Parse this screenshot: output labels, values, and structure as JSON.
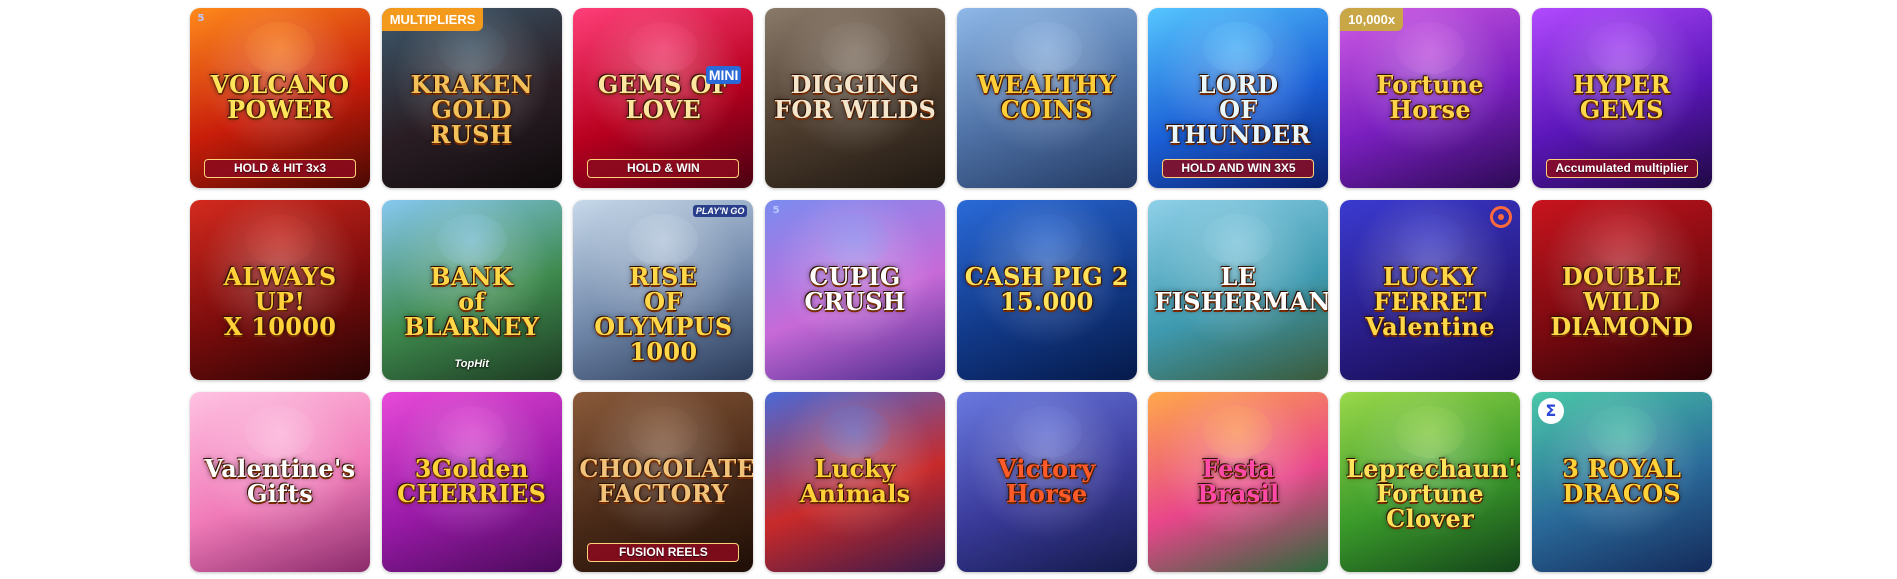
{
  "games": [
    {
      "title": "VOLCANO\nPOWER",
      "subtitle": "HOLD & HIT 3x3",
      "badge": "",
      "colors": [
        "#ff8a1c",
        "#c81d0a",
        "#4a0803"
      ],
      "title_color": "#ffe35a",
      "corner_icon": "five-icon"
    },
    {
      "title": "KRAKEN\nGOLD RUSH",
      "subtitle": "",
      "badge": "MULTIPLIERS",
      "colors": [
        "#3d5a6e",
        "#2a1e24",
        "#0e0a0c"
      ],
      "title_color": "#f2c15a",
      "corner_icon": ""
    },
    {
      "title": "GEMS OF LOVE",
      "subtitle": "HOLD & WIN",
      "badge": "",
      "colors": [
        "#ff3f7a",
        "#b8001f",
        "#4a0012"
      ],
      "title_color": "#ffe6a0",
      "corner_icon": "jackpot-mini-icon",
      "corner_text": "MINI"
    },
    {
      "title": "DIGGING\nFOR WILDS",
      "subtitle": "",
      "badge": "",
      "colors": [
        "#8a7a6a",
        "#4a3a2c",
        "#1f1812"
      ],
      "title_color": "#f4e6cc",
      "corner_icon": ""
    },
    {
      "title": "WEALTHY\nCOINS",
      "subtitle": "",
      "badge": "",
      "colors": [
        "#8fb9e8",
        "#4d6fa3",
        "#233a63"
      ],
      "title_color": "#ffcf3a",
      "corner_icon": ""
    },
    {
      "title": "LORD\nOF\nTHUNDER",
      "subtitle": "HOLD AND WIN 3X5",
      "badge": "",
      "colors": [
        "#56c6ff",
        "#1a5fd6",
        "#0a1e6a"
      ],
      "title_color": "#e9f7ff",
      "corner_icon": ""
    },
    {
      "title": "Fortune\nHorse",
      "subtitle": "",
      "badge": "10,000x",
      "colors": [
        "#d15ce6",
        "#7a1fbf",
        "#2c0a54"
      ],
      "title_color": "#ffd34a",
      "corner_icon": ""
    },
    {
      "title": "HYPER\nGEMS",
      "subtitle": "Accumulated multiplier",
      "badge": "",
      "colors": [
        "#b24aff",
        "#5a16b8",
        "#1f0844"
      ],
      "title_color": "#ffd84a",
      "corner_icon": ""
    },
    {
      "title": "ALWAYS UP!\nX 10000",
      "subtitle": "",
      "badge": "",
      "colors": [
        "#d42a1e",
        "#7a0c0c",
        "#2a0404"
      ],
      "title_color": "#ffd23a",
      "corner_icon": ""
    },
    {
      "title": "BANK\nof\nBLARNEY",
      "subtitle": "",
      "badge": "",
      "colors": [
        "#86c8f0",
        "#3e8a4e",
        "#1d3a22"
      ],
      "title_color": "#ffd84a",
      "corner_icon": "",
      "brand": "TopHit"
    },
    {
      "title": "RISE\nOF OLYMPUS\n1000",
      "subtitle": "",
      "badge": "",
      "colors": [
        "#c7d9ea",
        "#6f86a8",
        "#2a3a58"
      ],
      "title_color": "#ffd84a",
      "corner_icon": "play-n-go-icon",
      "corner_text": "PLAY'N GO"
    },
    {
      "title": "CUPIG CRUSH",
      "subtitle": "",
      "badge": "",
      "colors": [
        "#7b8cf0",
        "#c76ad8",
        "#4a2a8a"
      ],
      "title_color": "#ffffff",
      "corner_icon": "five-icon"
    },
    {
      "title": "CASH PIG 2\n15.000",
      "subtitle": "",
      "badge": "",
      "colors": [
        "#2a6ad8",
        "#123a8a",
        "#051a4a"
      ],
      "title_color": "#ffe35a",
      "corner_icon": ""
    },
    {
      "title": "LE FISHERMAN",
      "subtitle": "",
      "badge": "",
      "colors": [
        "#8fd0e8",
        "#3e9ab0",
        "#3a5a3a"
      ],
      "title_color": "#ffffff",
      "corner_icon": ""
    },
    {
      "title": "LUCKY\nFERRET\nValentine",
      "subtitle": "",
      "badge": "",
      "colors": [
        "#3a3ad0",
        "#2a1e8a",
        "#140a4a"
      ],
      "title_color": "#ffd84a",
      "corner_icon": "ring-icon"
    },
    {
      "title": "DOUBLE\nWILD DIAMOND",
      "subtitle": "",
      "badge": "",
      "colors": [
        "#c8141e",
        "#7a0a10",
        "#2a0206"
      ],
      "title_color": "#ffd84a",
      "corner_icon": ""
    },
    {
      "title": "Valentine's Gifts",
      "subtitle": "",
      "badge": "",
      "colors": [
        "#ffc2e2",
        "#f07ab8",
        "#8a2a6a"
      ],
      "title_color": "#ffffff",
      "corner_icon": ""
    },
    {
      "title": "3Golden\nCHERRIES",
      "subtitle": "",
      "badge": "",
      "colors": [
        "#e84ad8",
        "#9a1aa8",
        "#4a0a5a"
      ],
      "title_color": "#ffd23a",
      "corner_icon": ""
    },
    {
      "title": "CHOCOLATE\nFACTORY",
      "subtitle": "FUSION REELS",
      "badge": "",
      "colors": [
        "#8a5a3a",
        "#4a2a18",
        "#1e0e06"
      ],
      "title_color": "#f0c27a",
      "corner_icon": ""
    },
    {
      "title": "Lucky\nAnimals",
      "subtitle": "",
      "badge": "",
      "colors": [
        "#4a6ad8",
        "#c82a2a",
        "#3a1a4a"
      ],
      "title_color": "#ffd23a",
      "corner_icon": ""
    },
    {
      "title": "Victory Horse",
      "subtitle": "",
      "badge": "",
      "colors": [
        "#6a7ae0",
        "#3a3a9a",
        "#141a4a"
      ],
      "title_color": "#ff5a2a",
      "corner_icon": ""
    },
    {
      "title": "Festa\nBrasil",
      "subtitle": "",
      "badge": "",
      "colors": [
        "#ffa84a",
        "#e8468a",
        "#2a6a3a"
      ],
      "title_color": "#ff4aa8",
      "corner_icon": ""
    },
    {
      "title": "Leprechaun's\nFortune Clover",
      "subtitle": "",
      "badge": "",
      "colors": [
        "#9ad84a",
        "#3a9a2a",
        "#14441a"
      ],
      "title_color": "#ffe35a",
      "corner_icon": ""
    },
    {
      "title": "3 ROYAL\nDRACOS",
      "subtitle": "",
      "badge": "",
      "colors": [
        "#4ac8a8",
        "#2a6a9a",
        "#142a5a"
      ],
      "title_color": "#ffd23a",
      "corner_icon": "provider-swirl-icon",
      "corner_text": "Σ"
    }
  ]
}
